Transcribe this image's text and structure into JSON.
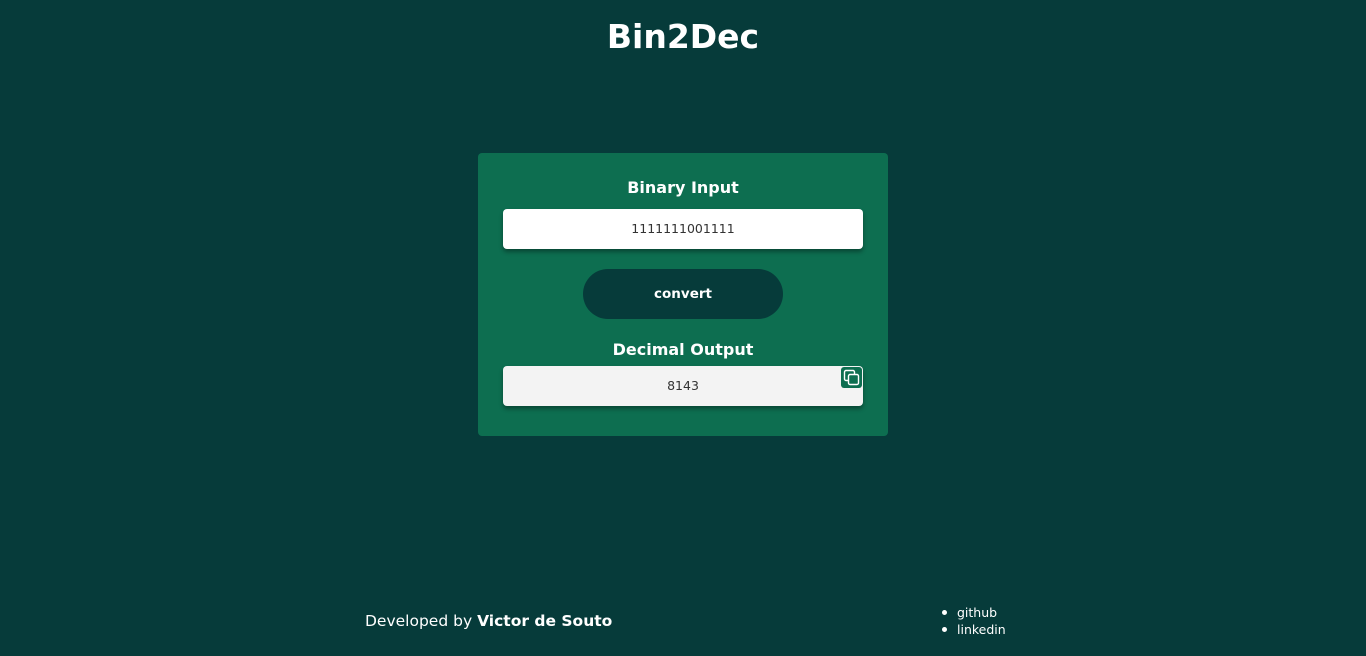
{
  "app": {
    "title": "Bin2Dec"
  },
  "converter": {
    "input_label": "Binary Input",
    "input_value": "1111111001111",
    "convert_label": "convert",
    "output_label": "Decimal Output",
    "output_value": "8143",
    "copy_icon": "copy-icon"
  },
  "footer": {
    "credit_prefix": "Developed by",
    "credit_name": "Victor de Souto",
    "links": [
      "github",
      "linkedin"
    ]
  },
  "colors": {
    "background": "#063b3a",
    "card": "#0d6e50",
    "button": "#063b3a",
    "text": "#ffffff"
  }
}
